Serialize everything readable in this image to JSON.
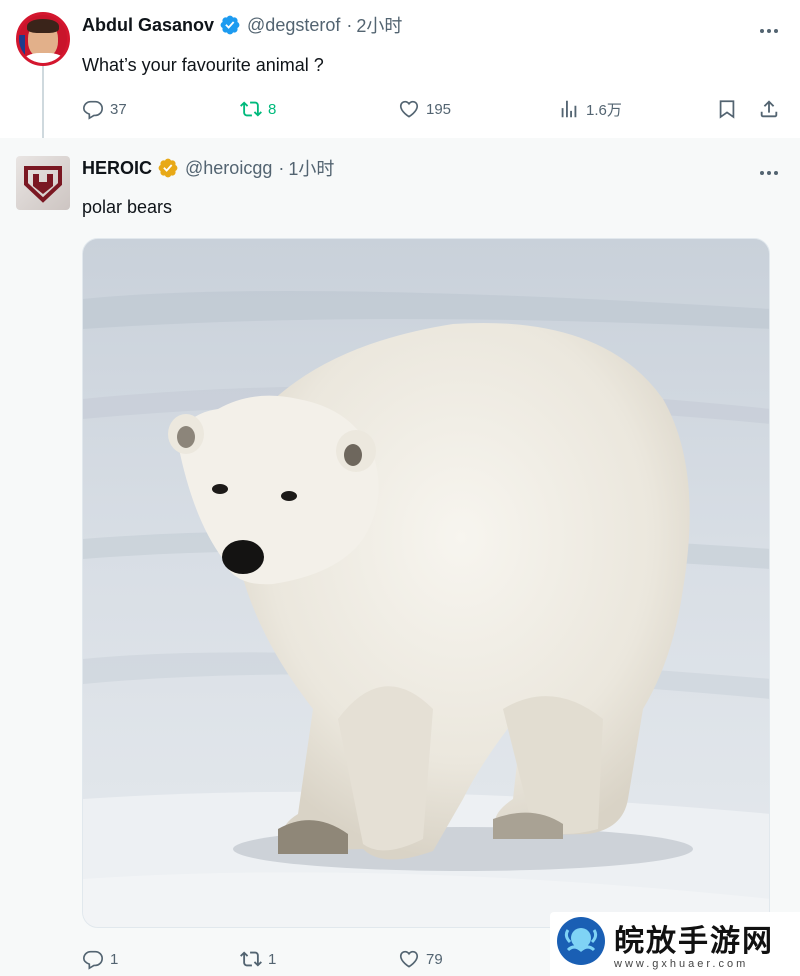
{
  "tweets": [
    {
      "author": {
        "name": "Abdul Gasanov",
        "handle": "@degsterof",
        "time": "2小时",
        "verified_color": "#1d9bf0"
      },
      "text": "What’s your favourite animal ?",
      "stats": {
        "replies": "37",
        "retweets": "8",
        "likes": "195",
        "views": "1.6万"
      }
    },
    {
      "author": {
        "name": "HEROIC",
        "handle": "@heroicgg",
        "time": "1小时",
        "verified_color": "#e8a917"
      },
      "text": "polar bears",
      "image_alt": "polar bear",
      "stats": {
        "replies": "1",
        "retweets": "1",
        "likes": "79"
      }
    }
  ],
  "colors": {
    "retweet_active": "#00ba7c",
    "secondary_text": "#536471",
    "thread_line": "#cfd9de"
  },
  "watermark": {
    "name": "皖放手游网",
    "url": "www.gxhuaer.com"
  }
}
